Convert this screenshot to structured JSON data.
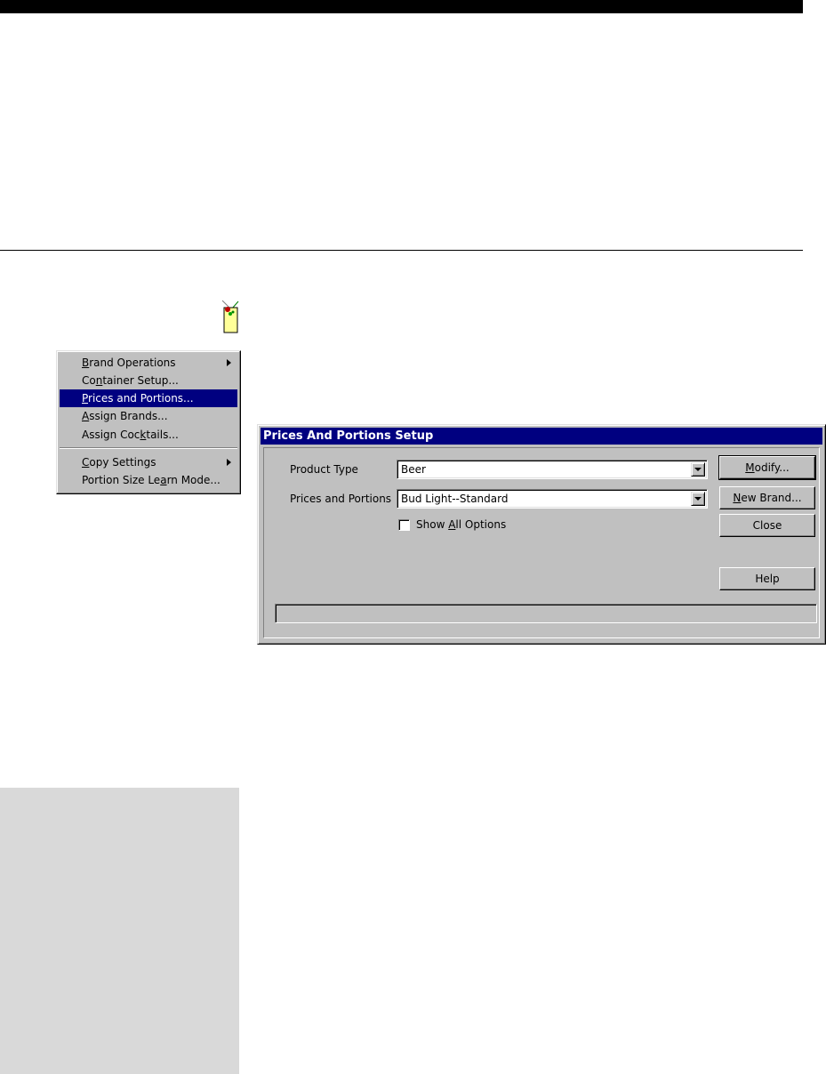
{
  "menu": {
    "items": [
      {
        "pre": "",
        "key": "B",
        "post": "rand Operations",
        "submenu": true
      },
      {
        "pre": "Co",
        "key": "n",
        "post": "tainer Setup...",
        "submenu": false
      },
      {
        "pre": "",
        "key": "P",
        "post": "rices and Portions...",
        "submenu": false,
        "selected": true
      },
      {
        "pre": "",
        "key": "A",
        "post": "ssign Brands...",
        "submenu": false
      },
      {
        "pre": "Assign Coc",
        "key": "k",
        "post": "tails...",
        "submenu": false
      },
      {
        "pre": "",
        "key": "C",
        "post": "opy Settings",
        "submenu": true
      },
      {
        "pre": "Portion Size Le",
        "key": "a",
        "post": "rn Mode...",
        "submenu": false
      }
    ]
  },
  "dialog": {
    "title": "Prices And Portions Setup",
    "product_type_label": "Product Type",
    "product_type_value": "Beer",
    "prices_label": "Prices and Portions",
    "prices_value": "Bud Light--Standard",
    "show_all": {
      "pre": "Show ",
      "key": "A",
      "post": "ll Options",
      "checked": false
    },
    "buttons": {
      "modify": {
        "pre": "",
        "key": "M",
        "post": "odify..."
      },
      "new_brand": {
        "pre": "",
        "key": "N",
        "post": "ew Brand..."
      },
      "close": "Close",
      "help": "Help"
    },
    "status_text": ""
  },
  "colors": {
    "selection": "#000080",
    "face": "#c0c0c0",
    "sidebar": "#d9d9d9"
  }
}
